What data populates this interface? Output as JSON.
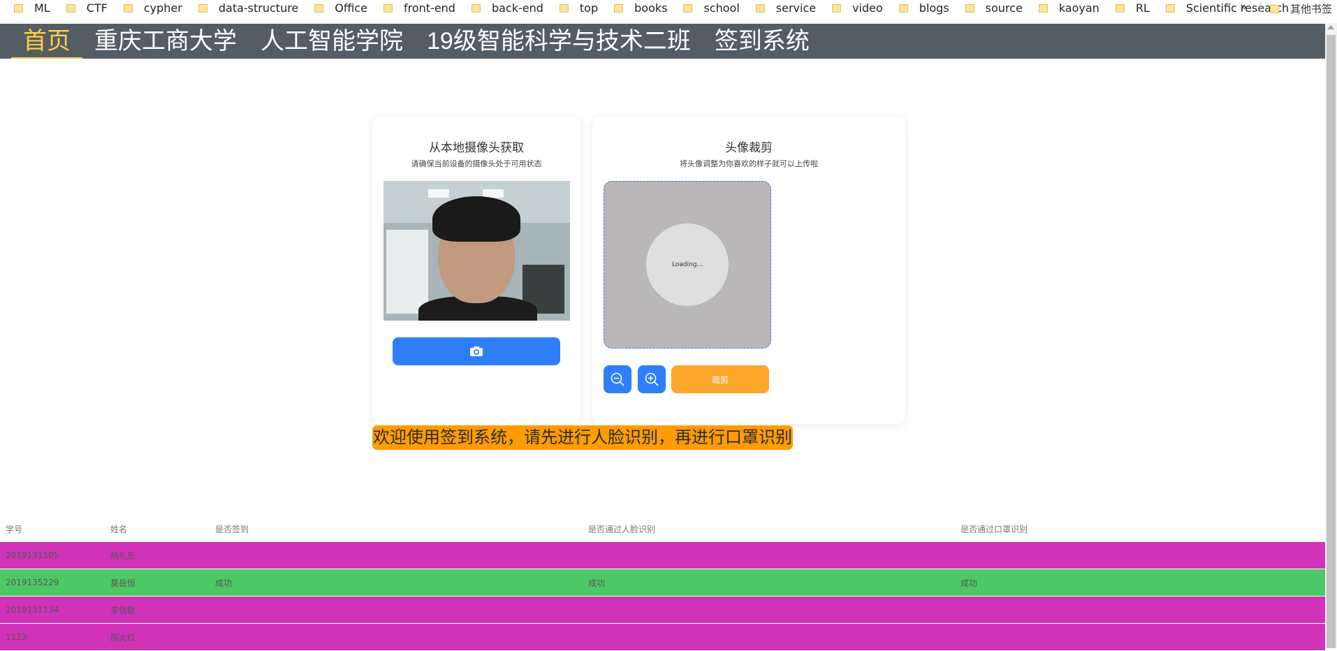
{
  "bookmarks": {
    "items": [
      {
        "label": "ML"
      },
      {
        "label": "CTF"
      },
      {
        "label": "cypher"
      },
      {
        "label": "data-structure"
      },
      {
        "label": "Office"
      },
      {
        "label": "front-end"
      },
      {
        "label": "back-end"
      },
      {
        "label": "top"
      },
      {
        "label": "books"
      },
      {
        "label": "school"
      },
      {
        "label": "service"
      },
      {
        "label": "video"
      },
      {
        "label": "blogs"
      },
      {
        "label": "source"
      },
      {
        "label": "kaoyan"
      },
      {
        "label": "RL"
      },
      {
        "label": "Scientific research"
      }
    ],
    "more": "»",
    "other": "其他书签",
    "folder_color": "#fbe49a"
  },
  "nav": {
    "items": [
      "首页",
      "重庆工商大学",
      "人工智能学院",
      "19级智能科学与技术二班",
      "签到系统"
    ],
    "active_index": 0,
    "bg_color": "#545c64",
    "active_color": "#ffd04b"
  },
  "camera_card": {
    "title": "从本地摄像头获取",
    "subtitle": "请确保当前设备的摄像头处于可用状态",
    "capture_icon": "camera-icon"
  },
  "crop_card": {
    "title": "头像裁剪",
    "subtitle": "将头像调整为你喜欢的样子就可以上传啦",
    "loading": "Loading...",
    "zoom_out_icon": "zoom-out-icon",
    "zoom_in_icon": "zoom-in-icon",
    "crop_label": "裁剪"
  },
  "welcome": "欢迎使用签到系统，请先进行人脸识别，再进行口罩识别",
  "table": {
    "headers": [
      "学号",
      "姓名",
      "是否签到",
      "是否通过人脸识别",
      "是否通过口罩识别"
    ],
    "rows": [
      {
        "cells": [
          "2019131105",
          "杨礼乐",
          "",
          "",
          ""
        ],
        "color": "#d033b8"
      },
      {
        "cells": [
          "2019135229",
          "莫岳恒",
          "成功",
          "成功",
          "成功"
        ],
        "color": "#4cc866"
      },
      {
        "cells": [
          "2019131134",
          "李信敏",
          "",
          "",
          ""
        ],
        "color": "#d033b8"
      },
      {
        "cells": [
          "1123",
          "陈大红",
          "",
          "",
          ""
        ],
        "color": "#d033b8"
      }
    ]
  },
  "colors": {
    "primary": "#2d7ff9",
    "warning": "#fda72c",
    "welcome_bg": "#ff9c00"
  }
}
